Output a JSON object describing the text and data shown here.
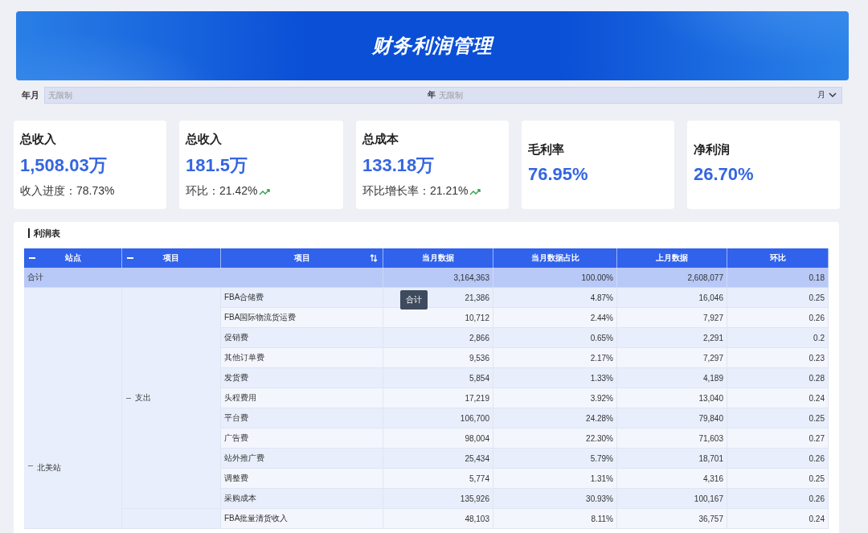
{
  "header": {
    "title": "财务利润管理"
  },
  "filter": {
    "label": "年月",
    "start": {
      "placeholder": "无限制"
    },
    "end_label": "年",
    "end": {
      "placeholder": "无限制"
    },
    "unit": "月"
  },
  "kpis": [
    {
      "title": "总收入",
      "value": "1,508.03万",
      "sub_label": "收入进度：",
      "sub_value": "78.73%"
    },
    {
      "title": "总收入",
      "value": "181.5万",
      "sub_label": "环比：",
      "sub_value": "21.42%",
      "trend_up": true
    },
    {
      "title": "总成本",
      "value": "133.18万",
      "sub_label": "环比增长率：",
      "sub_value": "21.21%",
      "trend_up": true
    },
    {
      "title": "毛利率",
      "value": "76.95%"
    },
    {
      "title": "净利润",
      "value": "26.70%"
    }
  ],
  "profit_table": {
    "title": "利润表",
    "columns": [
      {
        "label": "站点",
        "kind": "group",
        "expanded": true
      },
      {
        "label": "项目",
        "kind": "group",
        "expanded": true
      },
      {
        "label": "项目",
        "kind": "sort"
      },
      {
        "label": "当月数据",
        "kind": "plain"
      },
      {
        "label": "当月数据占比",
        "kind": "plain"
      },
      {
        "label": "上月数据",
        "kind": "plain"
      },
      {
        "label": "环比",
        "kind": "plain"
      }
    ],
    "total_row": {
      "label": "合计",
      "cells": [
        "3,164,363",
        "100.00%",
        "2,608,077",
        "0.18"
      ]
    },
    "tooltip": "合计",
    "stations": [
      {
        "label": "北美站",
        "expanded": true,
        "groups": [
          {
            "label": "支出",
            "expanded": true,
            "rows": [
              {
                "item": "FBA合储费",
                "cells": [
                  "21,386",
                  "4.87%",
                  "16,046",
                  "0.25"
                ]
              },
              {
                "item": "FBA国际物流货运费",
                "cells": [
                  "10,712",
                  "2.44%",
                  "7,927",
                  "0.26"
                ]
              },
              {
                "item": "促销费",
                "cells": [
                  "2,866",
                  "0.65%",
                  "2,291",
                  "0.2"
                ]
              },
              {
                "item": "其他订单费",
                "cells": [
                  "9,536",
                  "2.17%",
                  "7,297",
                  "0.23"
                ]
              },
              {
                "item": "发货费",
                "cells": [
                  "5,854",
                  "1.33%",
                  "4,189",
                  "0.28"
                ]
              },
              {
                "item": "头程费用",
                "cells": [
                  "17,219",
                  "3.92%",
                  "13,040",
                  "0.24"
                ]
              },
              {
                "item": "平台费",
                "cells": [
                  "106,700",
                  "24.28%",
                  "79,840",
                  "0.25"
                ]
              },
              {
                "item": "广告费",
                "cells": [
                  "98,004",
                  "22.30%",
                  "71,603",
                  "0.27"
                ]
              },
              {
                "item": "站外推广费",
                "cells": [
                  "25,434",
                  "5.79%",
                  "18,701",
                  "0.26"
                ]
              },
              {
                "item": "调整费",
                "cells": [
                  "5,774",
                  "1.31%",
                  "4,316",
                  "0.25"
                ]
              },
              {
                "item": "采购成本",
                "cells": [
                  "135,926",
                  "30.93%",
                  "100,167",
                  "0.26"
                ]
              }
            ]
          },
          {
            "rows": [
              {
                "item": "FBA批量清货收入",
                "cells": [
                  "48,103",
                  "8.11%",
                  "36,757",
                  "0.24"
                ]
              }
            ]
          }
        ]
      }
    ]
  }
}
